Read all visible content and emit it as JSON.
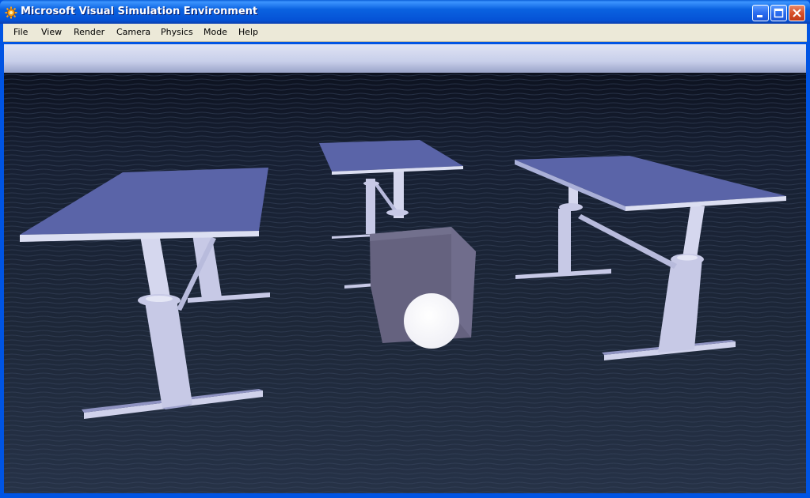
{
  "window": {
    "title": "Microsoft Visual Simulation Environment",
    "icon": "gear-sun-icon",
    "controls": [
      "minimize-icon",
      "maximize-icon",
      "close-icon"
    ]
  },
  "menu": {
    "items": [
      {
        "label": "File"
      },
      {
        "label": "View"
      },
      {
        "label": "Render"
      },
      {
        "label": "Camera"
      },
      {
        "label": "Physics"
      },
      {
        "label": "Mode"
      },
      {
        "label": "Help"
      }
    ]
  },
  "scene": {
    "sky_color": "#cfd6ee",
    "floor_color": "#1c2536",
    "table_color": "#5a64a8",
    "leg_color": "#c7c9e6",
    "box_color": "#65627f",
    "ball_color": "#ffffff"
  }
}
